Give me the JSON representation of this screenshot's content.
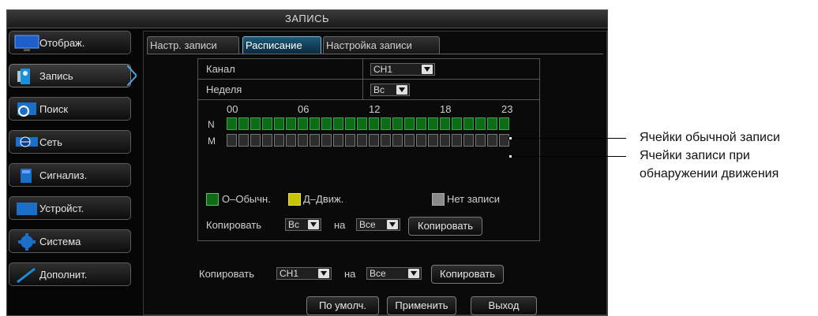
{
  "window": {
    "title": "ЗАПИСЬ"
  },
  "sidebar": {
    "items": [
      {
        "label": "Отображ.",
        "icon": "monitor-icon"
      },
      {
        "label": "Запись",
        "icon": "camera-icon"
      },
      {
        "label": "Поиск",
        "icon": "search-icon"
      },
      {
        "label": "Сеть",
        "icon": "network-icon"
      },
      {
        "label": "Сигнализ.",
        "icon": "alarm-icon"
      },
      {
        "label": "Устройст.",
        "icon": "device-icon"
      },
      {
        "label": "Система",
        "icon": "gear-icon"
      },
      {
        "label": "Дополнит.",
        "icon": "tools-icon"
      }
    ],
    "active_index": 1
  },
  "tabs": [
    {
      "label": "Настр. записи"
    },
    {
      "label": "Расписание"
    },
    {
      "label": "Настройка записи"
    }
  ],
  "active_tab": 1,
  "schedule": {
    "channel_label": "Канал",
    "channel_value": "CH1",
    "week_label": "Неделя",
    "week_value": "Вс",
    "hour_marks": [
      "00",
      "06",
      "12",
      "18",
      "23"
    ],
    "row_n_label": "N",
    "row_m_label": "M",
    "cell_count": 24
  },
  "legend": {
    "normal": "О–Обычн.",
    "motion": "Д–Движ.",
    "none": "Нет записи",
    "normal_color": "#0e6b16",
    "motion_color": "#c8c400",
    "none_color": "#8a8a8a"
  },
  "copy_day": {
    "label": "Копировать",
    "from": "Вс",
    "to_label": "на",
    "to": "Все",
    "button": "Копировать"
  },
  "copy_channel": {
    "label": "Копировать",
    "from": "CH1",
    "to_label": "на",
    "to": "Все",
    "button": "Копировать"
  },
  "footer": {
    "default": "По умолч.",
    "apply": "Применить",
    "exit": "Выход"
  },
  "annotations": {
    "normal_cells": "Ячейки обычной записи",
    "motion_cells_line1": "Ячейки записи при",
    "motion_cells_line2": "обнаружении движения"
  }
}
